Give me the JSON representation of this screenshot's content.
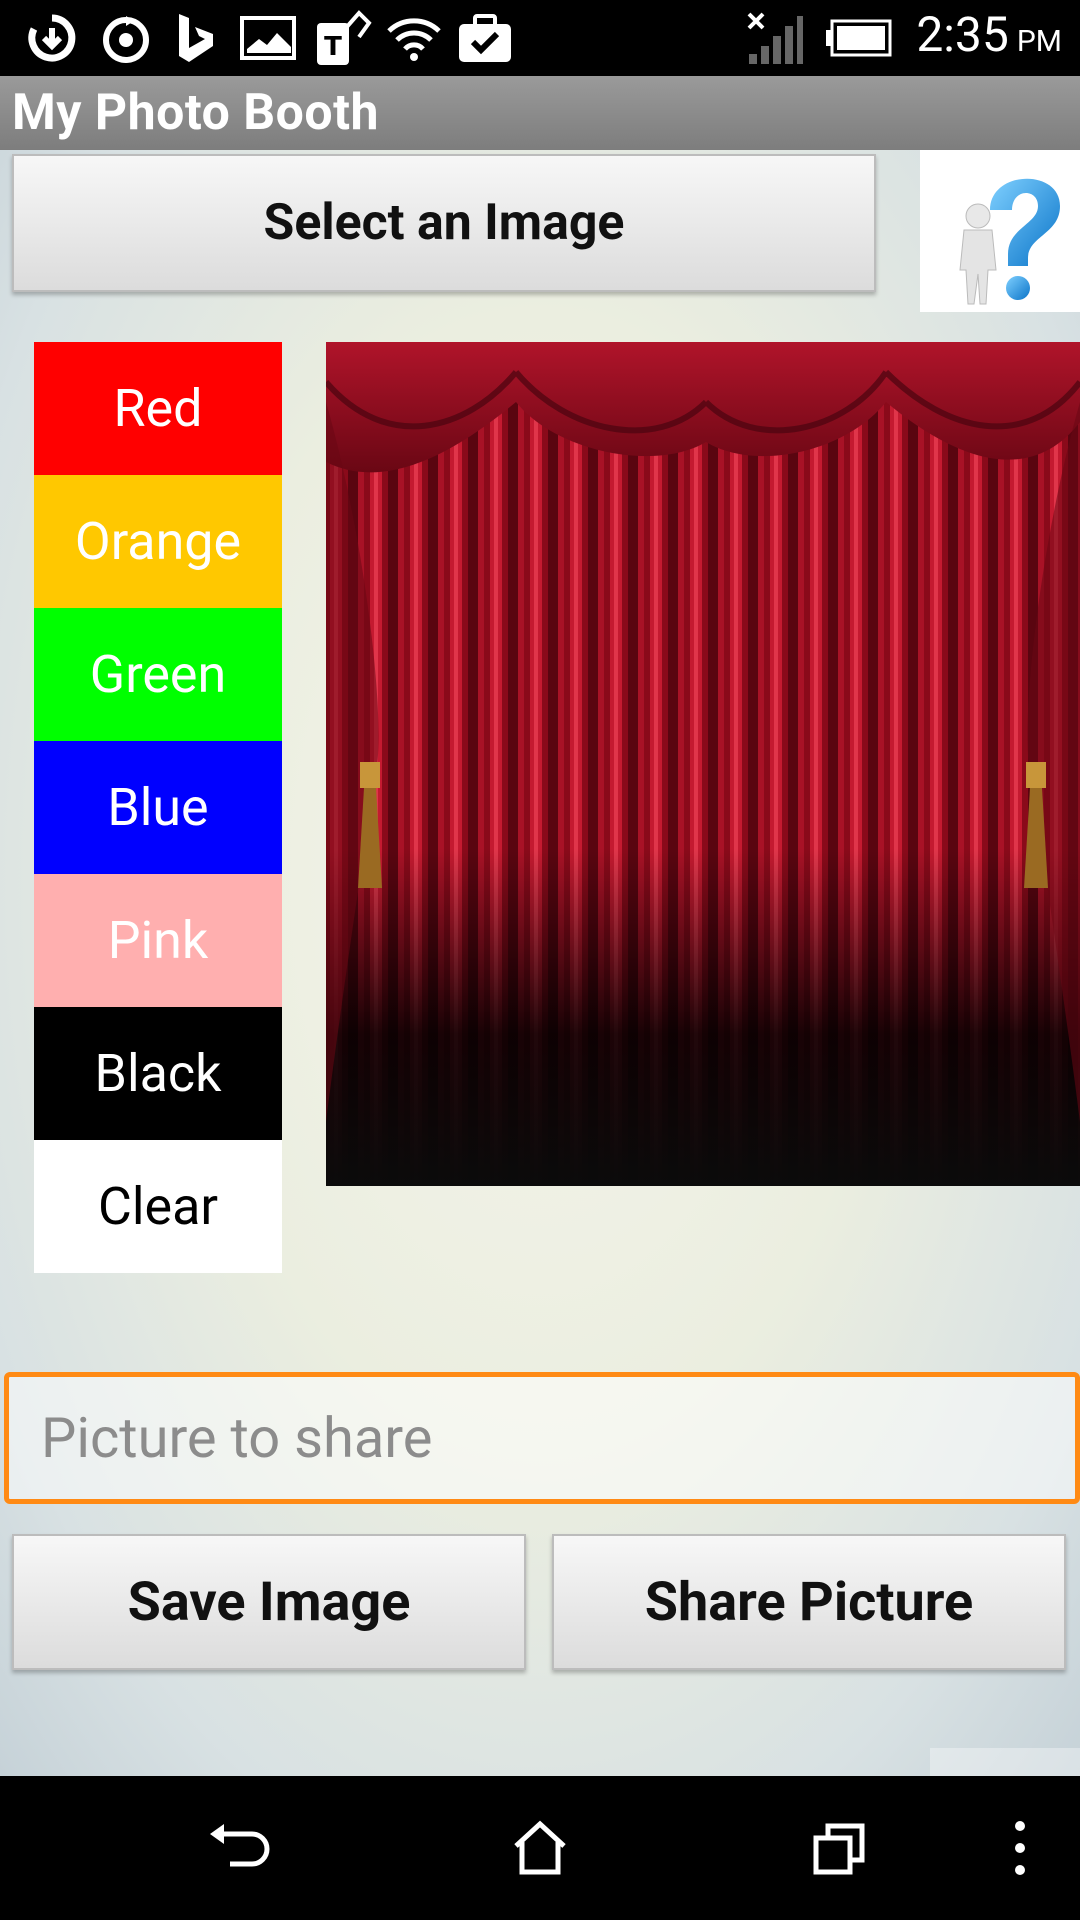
{
  "status_bar": {
    "time": "2:35",
    "ampm": "PM",
    "icons": [
      "sync-icon",
      "refresh-circle-icon",
      "bing-icon",
      "image-icon",
      "tmobile-tag-icon",
      "wifi-icon",
      "briefcase-check-icon",
      "signal-off-icon",
      "battery-icon"
    ]
  },
  "action_bar": {
    "title": "My Photo Booth"
  },
  "toolbar": {
    "select_image_label": "Select an Image"
  },
  "help": {
    "icon": "help-question-icon"
  },
  "colors": [
    {
      "label": "Red",
      "bg": "#ff0000",
      "fg": "#ffffff"
    },
    {
      "label": "Orange",
      "bg": "#ffc800",
      "fg": "#ffffff"
    },
    {
      "label": "Green",
      "bg": "#00ff00",
      "fg": "#ffffff"
    },
    {
      "label": "Blue",
      "bg": "#0000ff",
      "fg": "#ffffff"
    },
    {
      "label": "Pink",
      "bg": "#ffafaf",
      "fg": "#ffffff"
    },
    {
      "label": "Black",
      "bg": "#000000",
      "fg": "#ffffff"
    },
    {
      "label": "Clear",
      "bg": "#ffffff",
      "fg": "#000000"
    }
  ],
  "share": {
    "placeholder": "Picture to share",
    "value": ""
  },
  "actions": {
    "save_label": "Save Image",
    "share_label": "Share Picture"
  },
  "nav": {
    "back": "back-icon",
    "home": "home-icon",
    "recents": "recents-icon",
    "menu": "overflow-menu-icon"
  },
  "theme": {
    "accent": "#ff8a14",
    "curtain": "#9b0d1e"
  }
}
